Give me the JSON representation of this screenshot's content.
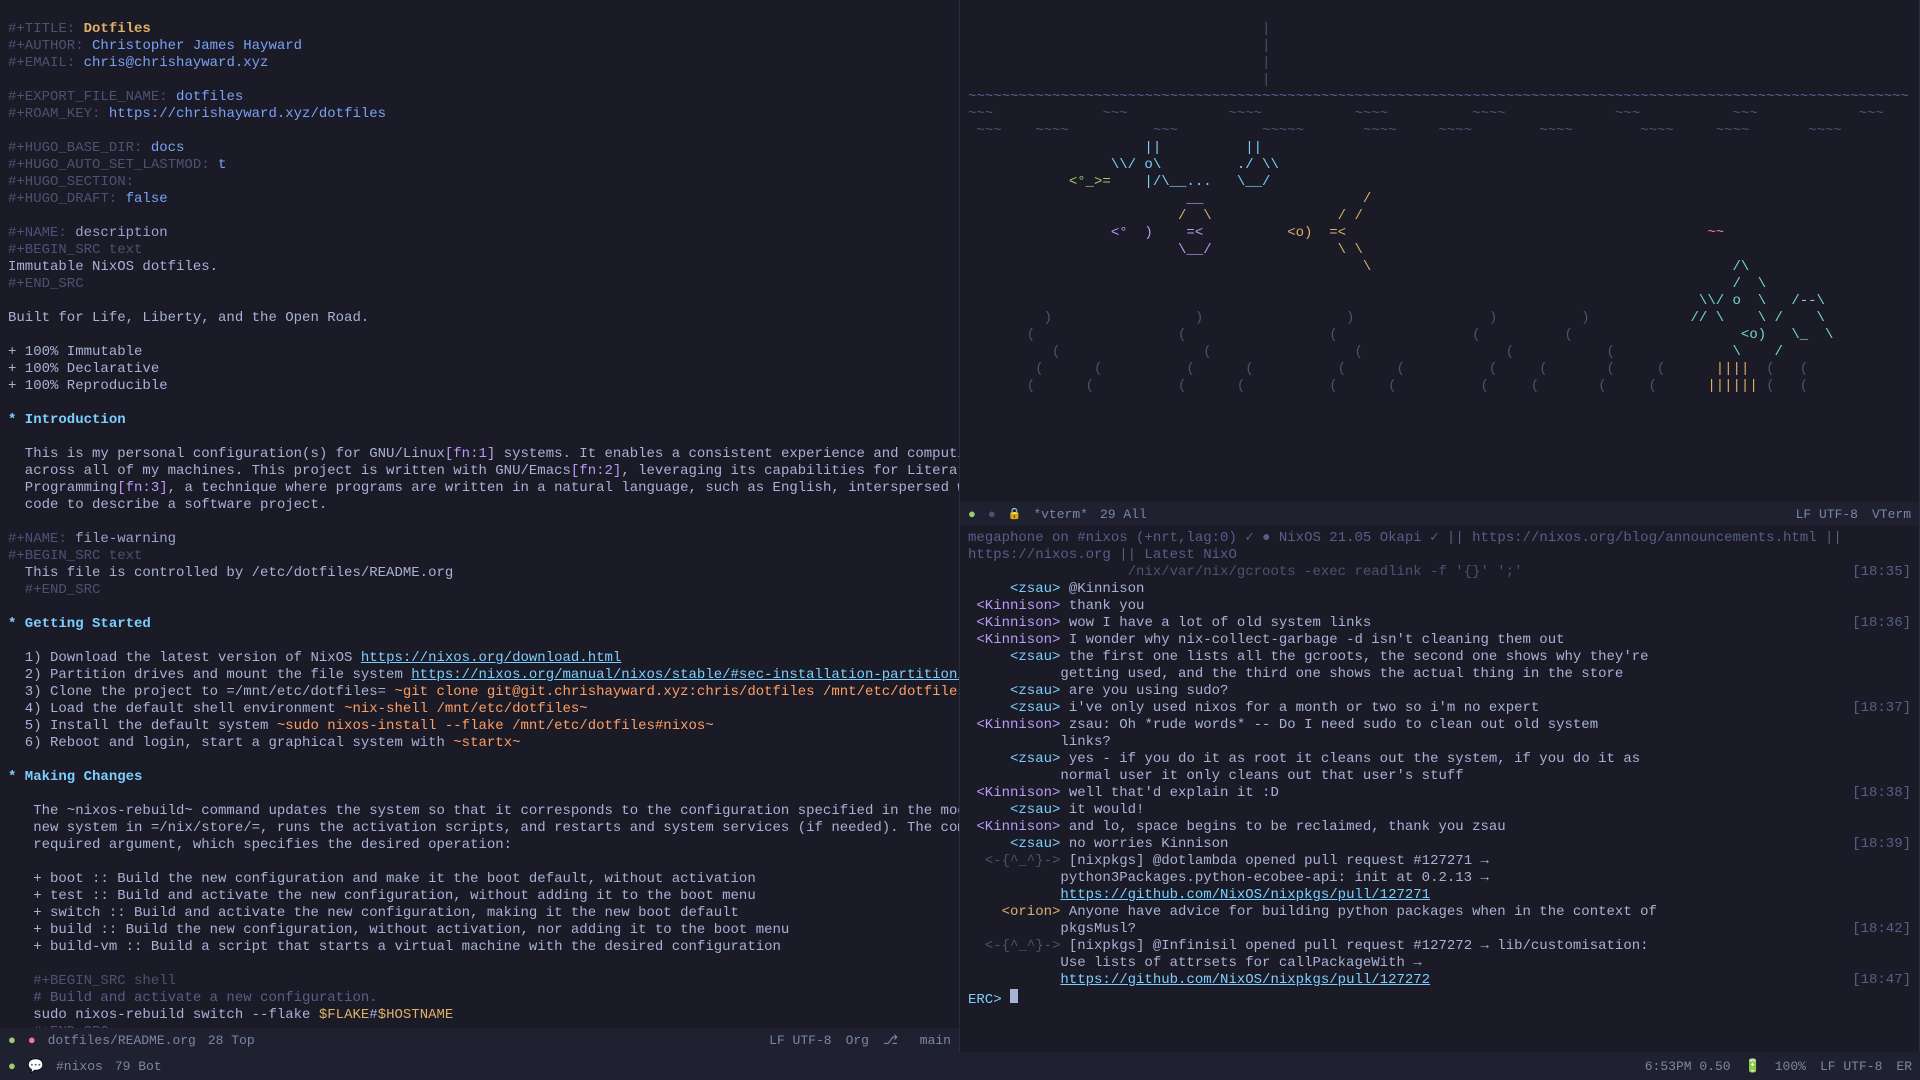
{
  "left": {
    "meta": {
      "title_k": "#+TITLE:",
      "title_v": "Dotfiles",
      "author_k": "#+AUTHOR:",
      "author_v": "Christopher James Hayward",
      "email_k": "#+EMAIL:",
      "email_v": "chris@chrishayward.xyz",
      "export_k": "#+EXPORT_FILE_NAME:",
      "export_v": "dotfiles",
      "roam_k": "#+ROAM_KEY:",
      "roam_v": "https://chrishayward.xyz/dotfiles",
      "hugo1_k": "#+HUGO_BASE_DIR:",
      "hugo1_v": "docs",
      "hugo2_k": "#+HUGO_AUTO_SET_LASTMOD:",
      "hugo2_v": "t",
      "hugo3_k": "#+HUGO_SECTION:",
      "hugo4_k": "#+HUGO_DRAFT:",
      "hugo4_v": "false"
    },
    "src1": {
      "name_k": "#+NAME:",
      "name_v": "description",
      "begin": "#+BEGIN_SRC text",
      "body": "Immutable NixOS dotfiles.",
      "end": "#+END_SRC"
    },
    "built": "Built for Life, Liberty, and the Open Road.",
    "bullets1": [
      "+ 100% Immutable",
      "+ 100% Declarative",
      "+ 100% Reproducible"
    ],
    "h1": "* Introduction",
    "intro1": "  This is my personal configuration(s) for GNU/Linux",
    "fn1": "[fn:1]",
    "intro1b": " systems. It enables a consistent experience and computing environment",
    "intro2": "  across all of my machines. This project is written with GNU/Emacs",
    "fn2": "[fn:2]",
    "intro2b": ", leveraging its capabilities for Literate",
    "intro3": "  Programming",
    "fn3": "[fn:3]",
    "intro3b": ", a technique where programs are written in a natural language, such as English, interspersed with snippets of",
    "intro4": "  code to describe a software project.",
    "src2": {
      "name_k": "#+NAME:",
      "name_v": "file-warning",
      "begin": "#+BEGIN_SRC text",
      "body": "  This file is controlled by /etc/dotfiles/README.org",
      "end": "  #+END_SRC"
    },
    "h2": "* Getting Started",
    "steps": [
      {
        "n": "  1) Download the latest version of NixOS ",
        "link": "https://nixos.org/download.html"
      },
      {
        "n": "  2) Partition drives and mount the file system ",
        "link": "https://nixos.org/manual/nixos/stable/#sec-installation-partitioning"
      },
      {
        "n": "  3) Clone the project to =/mnt/etc/dotfiles= ",
        "cmd": "~git clone git@git.chrishayward.xyz:chris/dotfiles /mnt/etc/dotfiles~"
      },
      {
        "n": "  4) Load the default shell environment ",
        "cmd": "~nix-shell /mnt/etc/dotfiles~"
      },
      {
        "n": "  5) Install the default system ",
        "cmd": "~sudo nixos-install --flake /mnt/etc/dotfiles#nixos~"
      },
      {
        "n": "  6) Reboot and login, start a graphical system with ",
        "cmd": "~startx~"
      }
    ],
    "h3": "* Making Changes",
    "mc1": "   The ~nixos-rebuild~ command updates the system so that it corresponds to the configuration specified in the module. It builds the",
    "mc2": "   new system in =/nix/store/=, runs the activation scripts, and restarts and system services (if needed). The command has one",
    "mc3": "   required argument, which specifies the desired operation:",
    "ops": [
      "   + boot :: Build the new configuration and make it the boot default, without activation",
      "   + test :: Build and activate the new configuration, without adding it to the boot menu",
      "   + switch :: Build and activate the new configuration, making it the new boot default",
      "   + build :: Build the new configuration, without activation, nor adding it to the boot menu",
      "   + build-vm :: Build a script that starts a virtual machine with the desired configuration"
    ],
    "src3": {
      "begin": "   #+BEGIN_SRC shell",
      "cmt": "   # Build and activate a new configuration.",
      "body": "   sudo nixos-rebuild switch --flake $FLAKE#$HOSTNAME",
      "end": "   #+END_SRC"
    },
    "modeline": {
      "file": "dotfiles/README.org",
      "pos": "28 Top",
      "enc": "LF UTF-8",
      "mode": "Org",
      "branch": "main"
    }
  },
  "vterm": {
    "modeline": {
      "buf": "*vterm*",
      "pos": "29 All",
      "enc": "LF UTF-8",
      "mode": "VTerm"
    }
  },
  "erc": {
    "topic": "megaphone on #nixos (+nrt,lag:0) ✓ ● NixOS 21.05 Okapi ✓ || https://nixos.org/blog/announcements.html || https://nixos.org || Latest NixO",
    "topic2": "                   /nix/var/nix/gcroots -exec readlink -f '{}' ';'",
    "ts1": "[18:35]",
    "lines": [
      {
        "nick": "zsau",
        "text": "@Kinnison"
      },
      {
        "nick": "Kinnison",
        "text": "thank you"
      },
      {
        "nick": "Kinnison",
        "text": "wow I have a lot of old system links",
        "ts": "[18:36]"
      },
      {
        "nick": "Kinnison",
        "text": "I wonder why nix-collect-garbage -d isn't cleaning them out"
      },
      {
        "nick": "zsau",
        "text": "the first one lists all the gcroots, the second one shows why they're"
      },
      {
        "cont": true,
        "text": "           getting used, and the third one shows the actual thing in the store"
      },
      {
        "nick": "zsau",
        "text": "are you using sudo?"
      },
      {
        "nick": "zsau",
        "text": "i've only used nixos for a month or two so i'm no expert",
        "ts": "[18:37]"
      },
      {
        "nick": "Kinnison",
        "text": "zsau: Oh *rude words* -- Do I need sudo to clean out old system"
      },
      {
        "cont": true,
        "text": "           links?"
      },
      {
        "nick": "zsau",
        "text": "yes - if you do it as root it cleans out the system, if you do it as"
      },
      {
        "cont": true,
        "text": "           normal user it only cleans out that user's stuff"
      },
      {
        "nick": "Kinnison",
        "text": "well that'd explain it :D",
        "ts": "[18:38]"
      },
      {
        "nick": "zsau",
        "text": "it would!"
      },
      {
        "nick": "Kinnison",
        "text": "and lo, space begins to be reclaimed, thank you zsau"
      },
      {
        "nick": "zsau",
        "text": "no worries Kinnison",
        "ts": "[18:39]"
      },
      {
        "nick": "-{^_^}-",
        "text": "[nixpkgs] @dotlambda opened pull request #127271 →"
      },
      {
        "cont": true,
        "text": "           python3Packages.python-ecobee-api: init at 0.2.13 →"
      },
      {
        "cont": true,
        "link": "https://github.com/NixOS/nixpkgs/pull/127271",
        "pad": "           "
      },
      {
        "nick": "orion",
        "text": "Anyone have advice for building python packages when in the context of"
      },
      {
        "cont": true,
        "text": "           pkgsMusl?",
        "ts": "[18:42]"
      },
      {
        "nick": "-{^_^}-",
        "text": "[nixpkgs] @Infinisil opened pull request #127272 → lib/customisation:"
      },
      {
        "cont": true,
        "text": "           Use lists of attrsets for callPackageWith →"
      },
      {
        "cont": true,
        "link": "https://github.com/NixOS/nixpkgs/pull/127272",
        "pad": "           ",
        "ts": "[18:47]"
      }
    ],
    "prompt": "ERC> ",
    "modeline": {
      "buf": "#nixos",
      "pos": "79 Bot",
      "time": "6:53PM 0.50",
      "bat": "100%",
      "enc": "LF UTF-8",
      "mode": "ER"
    }
  }
}
